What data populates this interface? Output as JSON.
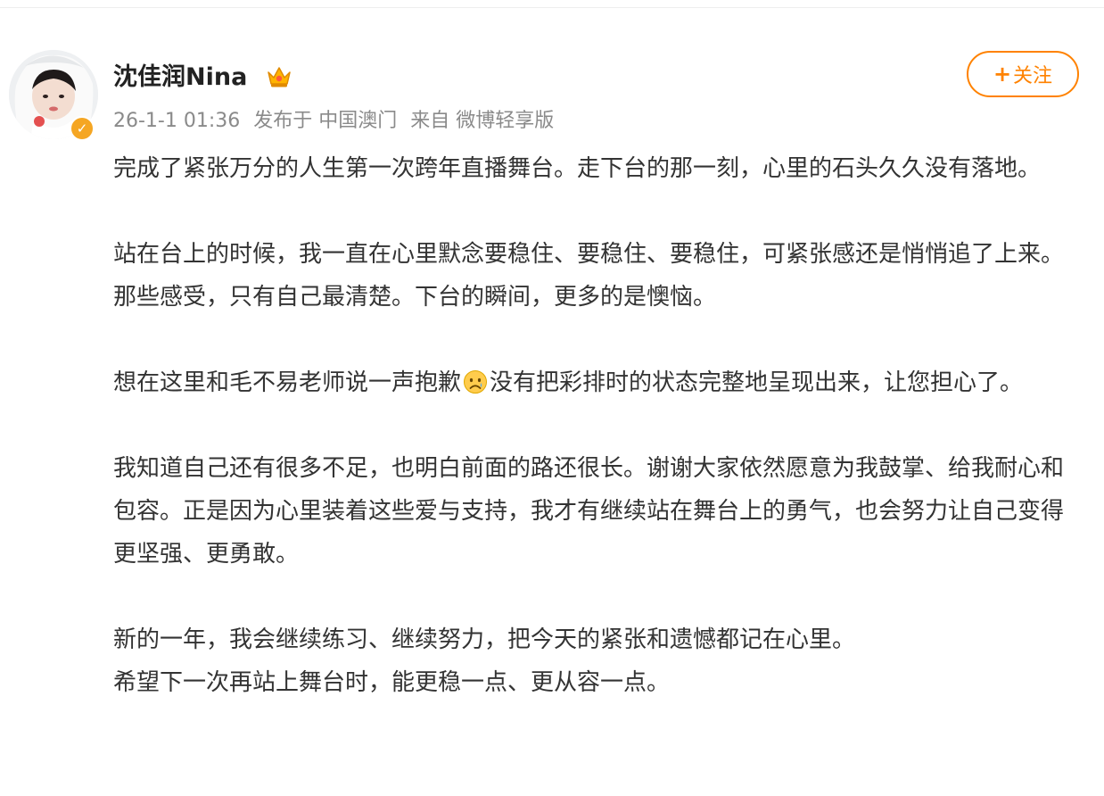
{
  "post": {
    "username": "沈佳润Nina",
    "timestamp": "26-1-1 01:36",
    "posted_from_label": "发布于 中国澳门",
    "source_label": "来自 微博轻享版",
    "follow_label": "关注",
    "paragraphs": [
      "完成了紧张万分的人生第一次跨年直播舞台。走下台的那一刻，心里的石头久久没有落地。",
      "站在台上的时候，我一直在心里默念要稳住、要稳住、要稳住，可紧张感还是悄悄追了上来。那些感受，只有自己最清楚。下台的瞬间，更多的是懊恼。",
      "我知道自己还有很多不足，也明白前面的路还很长。谢谢大家依然愿意为我鼓掌、给我耐心和包容。正是因为心里装着这些爱与支持，我才有继续站在舞台上的勇气，也会努力让自己变得更坚强、更勇敢。",
      "新的一年，我会继续练习、继续努力，把今天的紧张和遗憾都记在心里。",
      "希望下一次再站上舞台时，能更稳一点、更从容一点。"
    ],
    "apology_paragraph": {
      "before": "想在这里和毛不易老师说一声抱歉",
      "emoji": "sad-face-emoji",
      "after": "没有把彩排时的状态完整地呈现出来，让您担心了。"
    }
  },
  "icons": {
    "verified": "verified-badge-icon",
    "crown": "crown-icon",
    "emoji": "sad-face-emoji"
  },
  "colors": {
    "accent_orange": "#ff8200",
    "badge_gold": "#f5a623",
    "meta_gray": "#8a8a8a",
    "text": "#333333"
  }
}
